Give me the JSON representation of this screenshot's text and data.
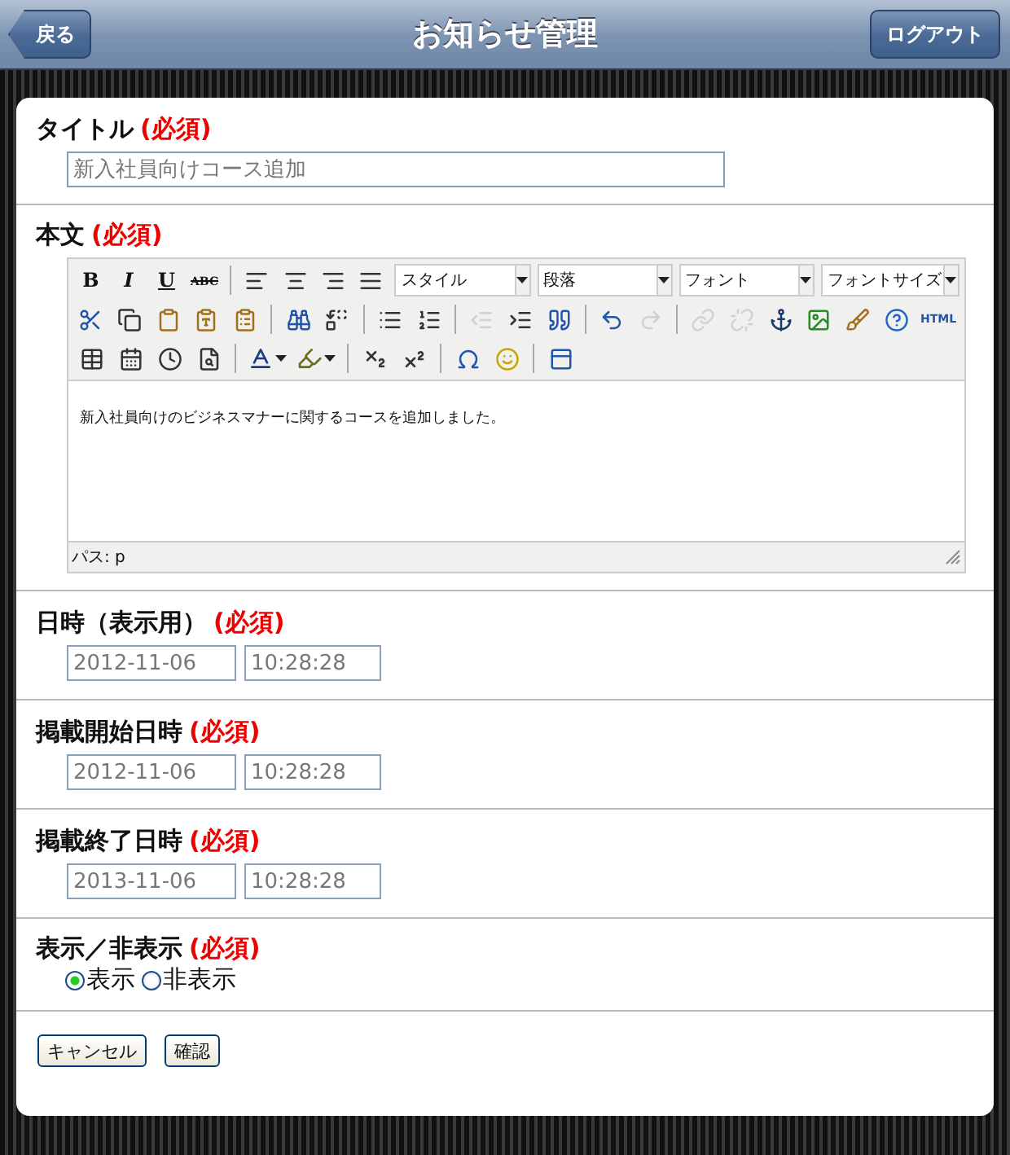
{
  "header": {
    "back_button": "戻る",
    "title": "お知らせ管理",
    "logout_button": "ログアウト"
  },
  "title_field": {
    "label": "タイトル",
    "required_mark": "(必須)",
    "value": "新入社員向けコース追加"
  },
  "body_field": {
    "label": "本文",
    "required_mark": "(必須)",
    "toolbar_rows": [
      [
        {
          "kind": "bold",
          "label": "B"
        },
        {
          "kind": "italic",
          "label": "I"
        },
        {
          "kind": "underline",
          "label": "U"
        },
        {
          "kind": "strike",
          "label": "ABC"
        },
        {
          "kind": "separator"
        },
        {
          "kind": "icon",
          "disabled": false
        },
        {
          "kind": "icon",
          "disabled": false
        },
        {
          "kind": "icon",
          "disabled": false
        },
        {
          "kind": "icon",
          "disabled": false
        },
        {
          "kind": "select",
          "label": "スタイル"
        },
        {
          "kind": "select",
          "label": "段落"
        },
        {
          "kind": "select",
          "label": "フォント"
        },
        {
          "kind": "select",
          "label": "フォントサイズ"
        }
      ],
      [
        {
          "kind": "icon",
          "disabled": false
        },
        {
          "kind": "icon",
          "disabled": false
        },
        {
          "kind": "icon",
          "disabled": false
        },
        {
          "kind": "icon",
          "disabled": false
        },
        {
          "kind": "icon",
          "disabled": false
        },
        {
          "kind": "separator"
        },
        {
          "kind": "icon",
          "disabled": false
        },
        {
          "kind": "icon",
          "disabled": false
        },
        {
          "kind": "separator"
        },
        {
          "kind": "icon",
          "disabled": false
        },
        {
          "kind": "icon",
          "disabled": false
        },
        {
          "kind": "separator"
        },
        {
          "kind": "icon",
          "disabled": true
        },
        {
          "kind": "icon",
          "disabled": false
        },
        {
          "kind": "icon",
          "disabled": false
        },
        {
          "kind": "separator"
        },
        {
          "kind": "icon",
          "disabled": false
        },
        {
          "kind": "icon",
          "disabled": true
        },
        {
          "kind": "separator"
        },
        {
          "kind": "icon",
          "disabled": true
        },
        {
          "kind": "icon",
          "disabled": true
        },
        {
          "kind": "icon",
          "disabled": false
        },
        {
          "kind": "icon",
          "disabled": false
        },
        {
          "kind": "icon",
          "disabled": false
        },
        {
          "kind": "icon",
          "disabled": false
        },
        {
          "kind": "html",
          "label": "HTML"
        }
      ],
      [
        {
          "kind": "icon",
          "disabled": false
        },
        {
          "kind": "icon",
          "disabled": false
        },
        {
          "kind": "icon",
          "disabled": false
        },
        {
          "kind": "icon",
          "disabled": false
        },
        {
          "kind": "separator"
        },
        {
          "kind": "split",
          "disabled": false
        },
        {
          "kind": "split",
          "disabled": false
        },
        {
          "kind": "separator"
        },
        {
          "kind": "icon",
          "disabled": false
        },
        {
          "kind": "icon",
          "disabled": false
        },
        {
          "kind": "separator"
        },
        {
          "kind": "icon",
          "disabled": false
        },
        {
          "kind": "icon",
          "disabled": false
        },
        {
          "kind": "separator"
        },
        {
          "kind": "icon",
          "disabled": false
        }
      ]
    ],
    "content": "新入社員向けのビジネスマナーに関するコースを追加しました。",
    "path": "パス: p"
  },
  "datetime_fields": [
    {
      "label": "日時（表示用）",
      "required_mark": "(必須)",
      "date": "2012-11-06",
      "time": "10:28:28"
    },
    {
      "label": "掲載開始日時",
      "required_mark": "(必須)",
      "date": "2012-11-06",
      "time": "10:28:28"
    },
    {
      "label": "掲載終了日時",
      "required_mark": "(必須)",
      "date": "2013-11-06",
      "time": "10:28:28"
    }
  ],
  "visibility_field": {
    "label": "表示／非表示",
    "required_mark": "(必須)",
    "options": [
      {
        "label": "表示",
        "selected": true
      },
      {
        "label": "非表示",
        "selected": false
      }
    ]
  },
  "buttons": [
    "キャンセル",
    "確認"
  ]
}
